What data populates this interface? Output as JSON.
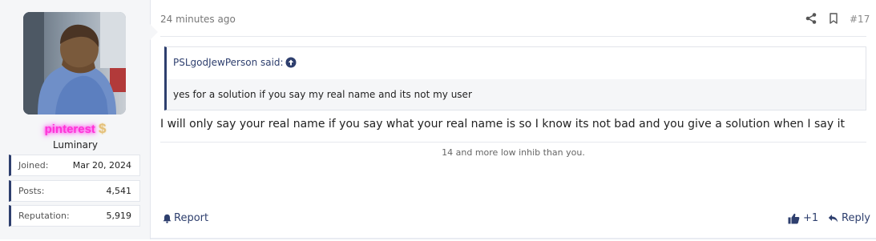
{
  "post": {
    "time": "24 minutes ago",
    "number": "#17",
    "message": "I will only say your real name if you say what your real name is so I know its not bad and you give a solution when I say it",
    "signature": "14 and more low inhib than you.",
    "actions": {
      "report": "Report",
      "like_count": "+1",
      "reply": "Reply"
    }
  },
  "user": {
    "name": "pinterest",
    "badge_icon": "dollar-sign-icon",
    "title": "Luminary",
    "stats": [
      {
        "label": "Joined:",
        "value": "Mar 20, 2024"
      },
      {
        "label": "Posts:",
        "value": "4,541"
      },
      {
        "label": "Reputation:",
        "value": "5,919"
      }
    ]
  },
  "quote": {
    "attribution": "PSLgodJewPerson said:",
    "text": "yes for a solution if you say my real name and its not my user"
  },
  "colors": {
    "accent": "#2e3f6e",
    "username_glow": "#ff33d6",
    "sidebar_bg": "#f5f6f8"
  }
}
